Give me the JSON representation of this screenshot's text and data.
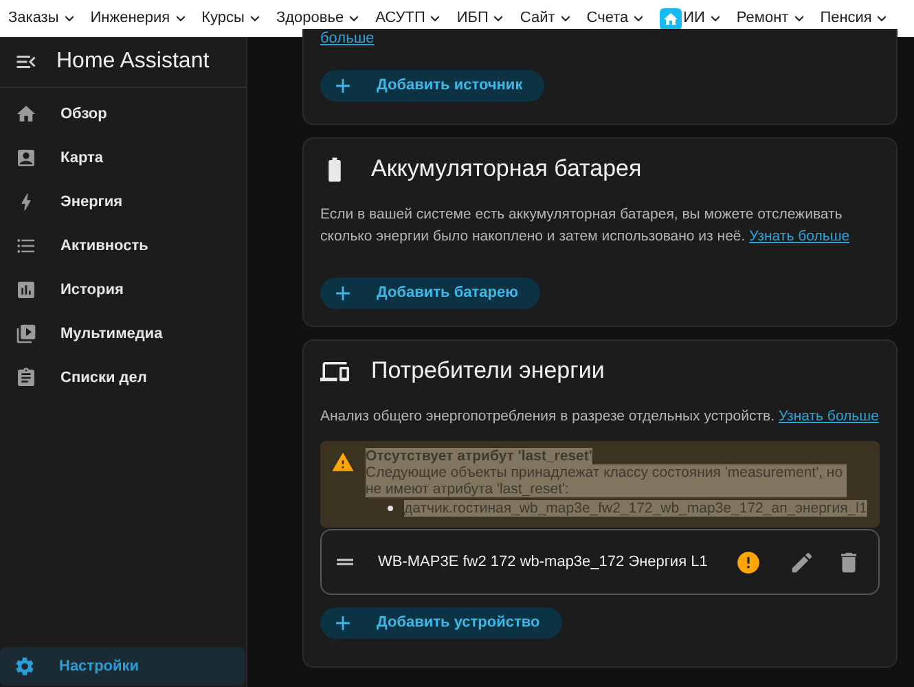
{
  "top_nav": [
    {
      "kind": "menu",
      "label": "Заказы"
    },
    {
      "kind": "menu",
      "label": "Инженерия"
    },
    {
      "kind": "menu",
      "label": "Курсы"
    },
    {
      "kind": "menu",
      "label": "Здоровье"
    },
    {
      "kind": "menu",
      "label": "АСУТП"
    },
    {
      "kind": "menu",
      "label": "ИБП"
    },
    {
      "kind": "menu",
      "label": "Сайт"
    },
    {
      "kind": "menu",
      "label": "Счета"
    },
    {
      "kind": "logo"
    },
    {
      "kind": "menu",
      "label": "ИИ"
    },
    {
      "kind": "menu",
      "label": "Ремонт"
    },
    {
      "kind": "menu",
      "label": "Пенсия"
    }
  ],
  "sidebar": {
    "title": "Home Assistant",
    "items": [
      {
        "kind": "overview",
        "label": "Обзор",
        "selected": false
      },
      {
        "kind": "map",
        "label": "Карта",
        "selected": false
      },
      {
        "kind": "energy",
        "label": "Энергия",
        "selected": false
      },
      {
        "kind": "logbook",
        "label": "Активность",
        "selected": false
      },
      {
        "kind": "history",
        "label": "История",
        "selected": false
      },
      {
        "kind": "media",
        "label": "Мультимедиа",
        "selected": false
      },
      {
        "kind": "todo",
        "label": "Списки дел",
        "selected": false
      }
    ],
    "settings": {
      "label": "Настройки",
      "selected": true
    }
  },
  "cards": [
    {
      "kind": "cut",
      "link": "больше",
      "button": "Добавить источник"
    },
    {
      "kind": "battery",
      "title": "Аккумуляторная батарея",
      "description": "Если в вашей системе есть аккумуляторная батарея, вы можете отслеживать сколько энергии было накоплено и затем использовано из неё.",
      "link": "Узнать больше",
      "button": "Добавить батарею"
    },
    {
      "kind": "devices",
      "title": "Потребители энергии",
      "description": "Анализ общего энергопотребления в разрезе отдельных устройств.",
      "link": "Узнать больше",
      "warning": {
        "title": "Отсутствует атрибут 'last_reset'",
        "text": "Следующие объекты принадлежат классу состояния 'measurement', но не имеют атрибута 'last_reset':",
        "entities": [
          "датчик.гостиная_wb_map3e_fw2_172_wb_map3e_172_ап_энергия_l1"
        ]
      },
      "devices": [
        {
          "name": "WB-MAP3E fw2 172 wb-map3e_172 Энергия L1",
          "warning": true
        }
      ],
      "button": "Добавить устройство"
    }
  ]
}
